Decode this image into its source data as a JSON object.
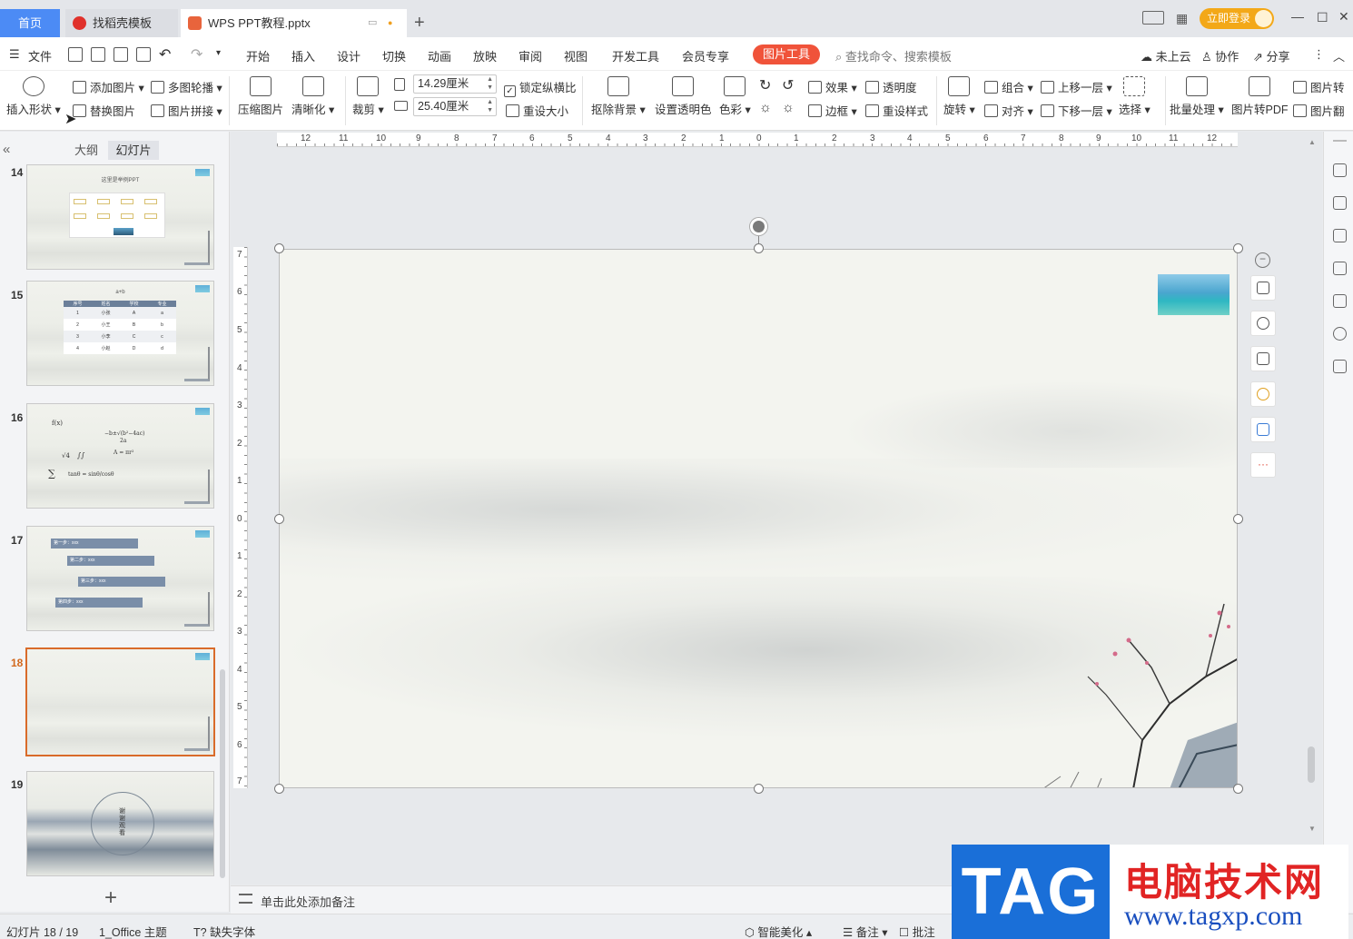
{
  "tabs": {
    "home": "首页",
    "template": "找稻壳模板",
    "doc": "WPS PPT教程.pptx",
    "login": "立即登录"
  },
  "menu": {
    "file": "文件",
    "items": [
      "开始",
      "插入",
      "设计",
      "切换",
      "动画",
      "放映",
      "审阅",
      "视图",
      "开发工具",
      "会员专享"
    ],
    "active": "图片工具",
    "search": "查找命令、搜索模板",
    "cloud": "未上云",
    "collab": "协作",
    "share": "分享"
  },
  "ribbon": {
    "insert_shape": "插入形状",
    "add_image": "添加图片",
    "replace_image": "替换图片",
    "multi_carousel": "多图轮播",
    "image_collage": "图片拼接",
    "compress": "压缩图片",
    "sharpen": "清晰化",
    "crop": "裁剪",
    "height": "14.29厘米",
    "width": "25.40厘米",
    "lock_ratio": "锁定纵横比",
    "reset_size": "重设大小",
    "remove_bg": "抠除背景",
    "set_transparent": "设置透明色",
    "color": "色彩",
    "effects": "效果",
    "transparency": "透明度",
    "border": "边框",
    "reset_style": "重设样式",
    "rotate": "旋转",
    "group": "组合",
    "align": "对齐",
    "bring_forward": "上移一层",
    "send_backward": "下移一层",
    "select": "选择",
    "batch": "批量处理",
    "to_pdf": "图片转PDF",
    "img_convert": "图片转",
    "img_translate": "图片翻"
  },
  "left_panel": {
    "tab_outline": "大纲",
    "tab_slides": "幻灯片",
    "slides": [
      {
        "num": "14",
        "title": "这里是举例PPT"
      },
      {
        "num": "15",
        "formula": "a+b",
        "headers": [
          "序号",
          "姓名",
          "学校",
          "专业"
        ],
        "rows": [
          [
            "1",
            "小张",
            "A",
            "a"
          ],
          [
            "2",
            "小王",
            "B",
            "b"
          ],
          [
            "3",
            "小李",
            "C",
            "c"
          ],
          [
            "4",
            "小赵",
            "D",
            "d"
          ]
        ]
      },
      {
        "num": "16",
        "formulas": [
          "f(x)",
          "−b±√(b²−4ac)",
          "2a",
          "A = πr²",
          "tanθ = sinθ/cosθ",
          "√4",
          "∫∫",
          "∑"
        ]
      },
      {
        "num": "17",
        "steps": [
          "第一步：xxx",
          "第二步：xxx",
          "第三步：xxx",
          "第四步：xxx"
        ]
      },
      {
        "num": "18"
      },
      {
        "num": "19",
        "text": "谢谢观看"
      }
    ]
  },
  "rulers": {
    "h": [
      "12",
      "11",
      "10",
      "9",
      "8",
      "7",
      "6",
      "5",
      "4",
      "3",
      "2",
      "1",
      "0",
      "1",
      "2",
      "3",
      "4",
      "5",
      "6",
      "7",
      "8",
      "9",
      "10",
      "11",
      "12"
    ],
    "v": [
      "7",
      "6",
      "5",
      "4",
      "3",
      "2",
      "1",
      "0",
      "1",
      "2",
      "3",
      "4",
      "5",
      "6",
      "7"
    ]
  },
  "notes": {
    "placeholder": "单击此处添加备注"
  },
  "status": {
    "slide_count": "幻灯片 18 / 19",
    "theme": "1_Office 主题",
    "missing_font": "缺失字体",
    "beautify": "智能美化",
    "notes": "备注",
    "comments": "批注"
  },
  "watermark": {
    "tag": "TAG",
    "title": "电脑技术网",
    "url": "www.tagxp.com"
  }
}
